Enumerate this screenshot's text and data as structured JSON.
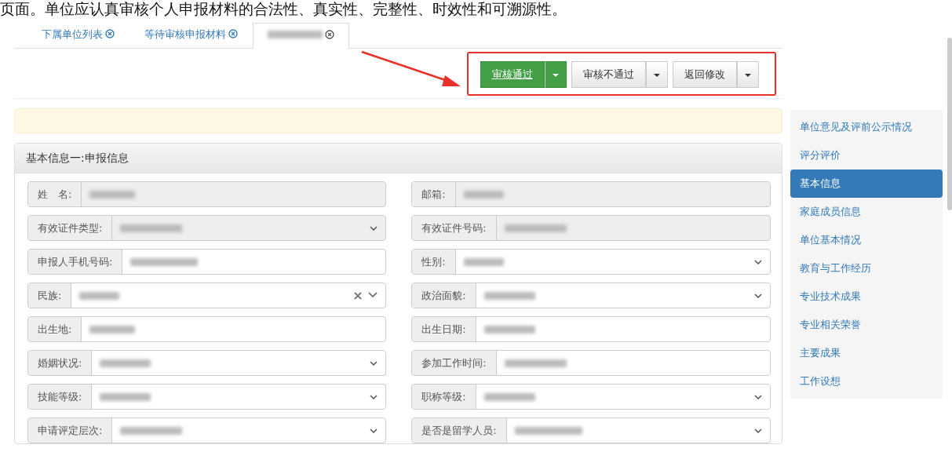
{
  "caption": "页面。单位应认真审核个人申报材料的合法性、真实性、完整性、时效性和可溯源性。",
  "tabs": [
    {
      "label": "下属单位列表",
      "selected": false,
      "redacted": false
    },
    {
      "label": "等待审核申报材料",
      "selected": false,
      "redacted": false
    },
    {
      "selected": true,
      "redacted": true
    }
  ],
  "actions": [
    {
      "label": "审核通过"
    },
    {
      "label": "审核不通过"
    },
    {
      "label": "返回修改"
    }
  ],
  "annotation_arrow": {
    "color": "#e8312a"
  },
  "annotation_box": {
    "color": "#e8312a"
  },
  "panel": {
    "title": "基本信息一:申报信息",
    "fields": [
      {
        "label": "姓　名:",
        "kind": "text",
        "readonly": true
      },
      {
        "label": "邮箱:",
        "kind": "text",
        "readonly": true
      },
      {
        "label": "有效证件类型:",
        "kind": "select",
        "readonly": true
      },
      {
        "label": "有效证件号码:",
        "kind": "text",
        "readonly": true
      },
      {
        "label": "申报人手机号码:",
        "kind": "text",
        "readonly": false
      },
      {
        "label": "性别:",
        "kind": "select",
        "readonly": false
      },
      {
        "label": "民族:",
        "kind": "combo",
        "readonly": false
      },
      {
        "label": "政治面貌:",
        "kind": "select",
        "readonly": false
      },
      {
        "label": "出生地:",
        "kind": "text",
        "readonly": false
      },
      {
        "label": "出生日期:",
        "kind": "text",
        "readonly": false
      },
      {
        "label": "婚姻状况:",
        "kind": "select",
        "readonly": false
      },
      {
        "label": "参加工作时间:",
        "kind": "text",
        "readonly": false
      },
      {
        "label": "技能等级:",
        "kind": "select",
        "readonly": false
      },
      {
        "label": "职称等级:",
        "kind": "select",
        "readonly": false
      },
      {
        "label": "申请评定层次:",
        "kind": "select",
        "readonly": false
      },
      {
        "label": "是否是留学人员:",
        "kind": "select",
        "readonly": false
      }
    ]
  },
  "sidebar": {
    "items": [
      {
        "label": "单位意见及评前公示情况",
        "selected": false
      },
      {
        "label": "评分评价",
        "selected": false
      },
      {
        "label": "基本信息",
        "selected": true
      },
      {
        "label": "家庭成员信息",
        "selected": false
      },
      {
        "label": "单位基本情况",
        "selected": false
      },
      {
        "label": "教育与工作经历",
        "selected": false
      },
      {
        "label": "专业技术成果",
        "selected": false
      },
      {
        "label": "专业相关荣誉",
        "selected": false
      },
      {
        "label": "主要成果",
        "selected": false
      },
      {
        "label": "工作设想",
        "selected": false
      }
    ]
  }
}
